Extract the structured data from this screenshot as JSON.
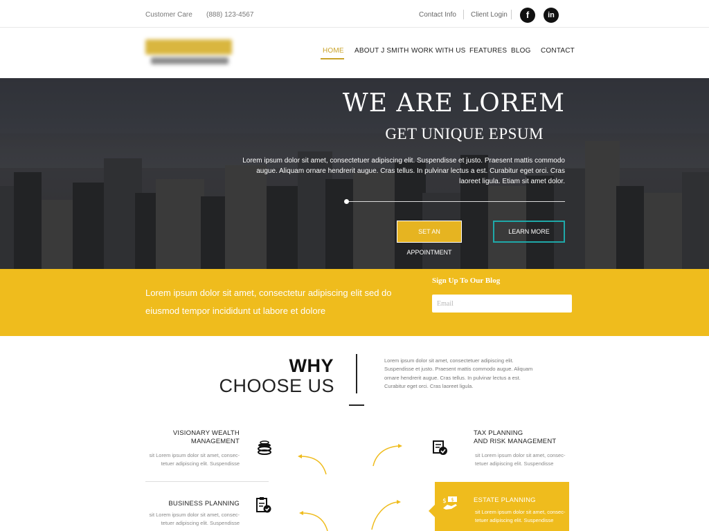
{
  "topbar": {
    "customer_care": "Customer Care",
    "phone": "(888) 123-4567",
    "contact_info": "Contact Info",
    "client_login": "Client Login",
    "facebook_glyph": "f",
    "linkedin_glyph": "in",
    "icons": [
      "facebook-icon",
      "linkedin-icon"
    ]
  },
  "nav": {
    "items": [
      "HOME",
      "ABOUT J SMITH",
      "WORK WITH US",
      "FEATURES",
      "BLOG",
      "CONTACT"
    ],
    "active": "HOME",
    "accent_color": "#c9a227"
  },
  "hero": {
    "title": "WE ARE LOREM",
    "subtitle": "GET UNIQUE EPSUM",
    "lead": "Lorem ipsum dolor sit amet, consectetuer adipiscing elit. Suspendisse et justo. Praesent mattis commodo augue. Aliquam ornare hendrerit augue. Cras tellus. In pulvinar lectus a est. Curabitur eget orci. Cras laoreet ligula. Etiam sit amet dolor.",
    "appointment_label": "SET AN APPOINTMENT",
    "learn_more_label": "LEARN MORE",
    "appointment_color": "#e6b421",
    "learn_more_border_color": "#1fa9a9"
  },
  "band": {
    "message": "Lorem ipsum dolor sit amet, consectetur adipiscing elit sed do eiusmod tempor incididunt ut labore et dolore",
    "signup_title": "Sign Up To Our Blog",
    "email_placeholder": "Email",
    "color": "#efbc1d"
  },
  "why": {
    "line1": "WHY",
    "line2": "CHOOSE US",
    "intro": "Lorem ipsum dolor sit amet, consectetuer adipiscing elit. Suspendisse et justo. Praesent mattis commodo augue. Aliquam ornare hendrerit augue. Cras tellus. In pulvinar lectus a est. Curabitur eget orci. Cras laoreet ligula.",
    "features": [
      {
        "title_line1": "VISIONARY WEALTH",
        "title_line2": "MANAGEMENT",
        "desc_line1": "sit Lorem ipsum dolor sit amet, consec-",
        "desc_line2": "tetuer adipiscing elit. Suspendisse",
        "icon": "coins-icon"
      },
      {
        "title_line1": "TAX PLANNING",
        "title_line2": "AND RISK MANAGEMENT",
        "desc_line1": "sit Lorem ipsum dolor sit amet, consec-",
        "desc_line2": "tetuer adipiscing elit. Suspendisse",
        "icon": "document-check-icon"
      },
      {
        "title_line1": "BUSINESS PLANNING",
        "title_line2": "",
        "desc_line1": "sit Lorem ipsum dolor sit amet, consec-",
        "desc_line2": "tetuer adipiscing elit. Suspendisse",
        "icon": "clipboard-check-icon"
      },
      {
        "title_line1": "ESTATE PLANNING",
        "title_line2": "",
        "desc_line1": "sit Lorem ipsum dolor sit amet, consec-",
        "desc_line2": "tetuer adipiscing elit. Suspendisse",
        "icon": "money-hand-icon"
      }
    ]
  }
}
